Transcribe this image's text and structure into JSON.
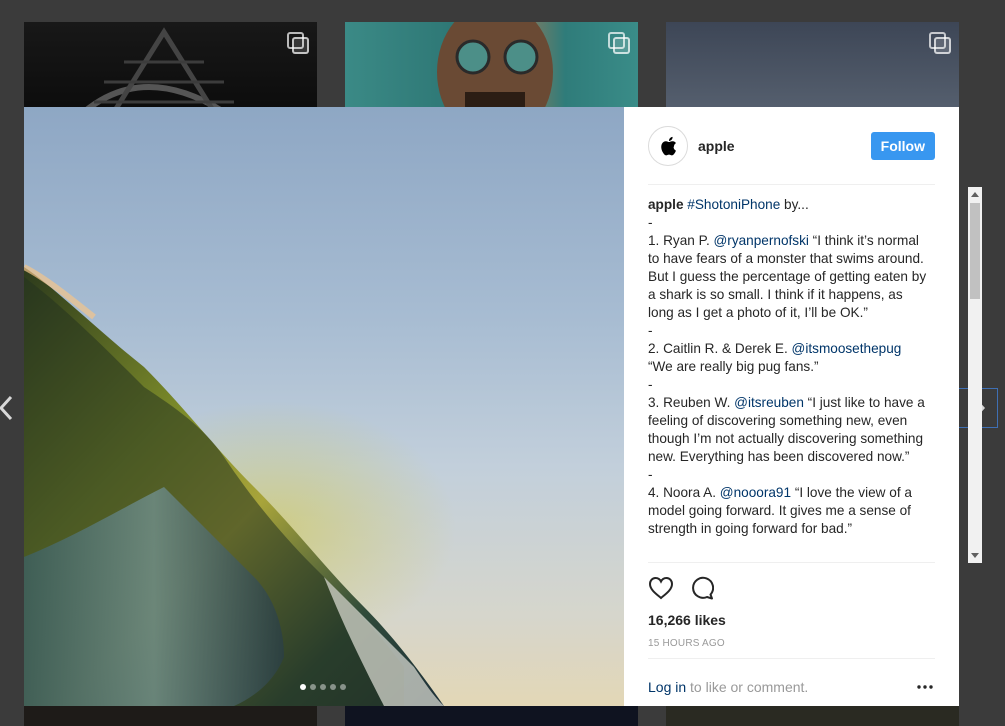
{
  "post": {
    "username": "apple",
    "follow_label": "Follow",
    "caption": {
      "user": "apple",
      "hashtag": "#ShotoniPhone",
      "after_hashtag": " by...",
      "lines": [
        {
          "type": "sep",
          "text": "-"
        },
        {
          "type": "entry",
          "prefix": "1. Ryan P. ",
          "mention": "@ryanpernofski",
          "text": " “I think it’s normal to have fears of a monster that swims around. But I guess the percentage of getting eaten by a shark is so small. I think if it happens, as long as I get a photo of it, I’ll be OK.”"
        },
        {
          "type": "sep",
          "text": "-"
        },
        {
          "type": "entry",
          "prefix": "2. Caitlin R. & Derek E. ",
          "mention": "@itsmoosethepug",
          "text": " “We are really big pug fans.”"
        },
        {
          "type": "sep",
          "text": "-"
        },
        {
          "type": "entry",
          "prefix": "3. Reuben W. ",
          "mention": "@itsreuben",
          "text": " “I just like to have a feeling of discovering something new, even though I’m not actually discovering something new. Everything has been discovered now.”"
        },
        {
          "type": "sep",
          "text": "-"
        },
        {
          "type": "entry",
          "prefix": "4. Noora A. ",
          "mention": "@nooora91",
          "text": " “I love the view of a model going forward. It gives me a sense of strength in going forward for bad.”"
        }
      ]
    },
    "likes": "16,266 likes",
    "timestamp": "15 HOURS AGO",
    "comment": {
      "login_label": "Log in",
      "rest": " to like or comment."
    },
    "carousel": {
      "count": 5,
      "active": 0
    }
  },
  "icons": {
    "avatar": "apple-logo-icon",
    "like": "heart-icon",
    "comment": "speech-bubble-icon",
    "more": "more-horizontal-icon",
    "prev": "chevron-left-icon",
    "next": "chevron-right-icon",
    "multi": "multiple-photos-icon"
  },
  "colors": {
    "follow_bg": "#3897f0",
    "link": "#003569",
    "muted": "#999999",
    "overlay_bg": "#3b3b3b"
  }
}
